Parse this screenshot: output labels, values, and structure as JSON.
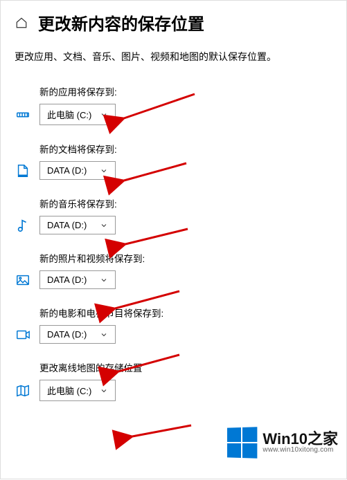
{
  "header": {
    "title": "更改新内容的保存位置"
  },
  "subtitle": "更改应用、文档、音乐、图片、视频和地图的默认保存位置。",
  "options": {
    "pc": "此电脑 (C:)",
    "data": "DATA (D:)"
  },
  "rows": [
    {
      "label": "新的应用将保存到:",
      "value": "此电脑 (C:)",
      "icon": "apps"
    },
    {
      "label": "新的文档将保存到:",
      "value": "DATA (D:)",
      "icon": "documents"
    },
    {
      "label": "新的音乐将保存到:",
      "value": "DATA (D:)",
      "icon": "music"
    },
    {
      "label": "新的照片和视频将保存到:",
      "value": "DATA (D:)",
      "icon": "photos"
    },
    {
      "label": "新的电影和电视节目将保存到:",
      "value": "DATA (D:)",
      "icon": "movies"
    },
    {
      "label": "更改离线地图的存储位置",
      "value": "此电脑 (C:)",
      "icon": "maps"
    }
  ],
  "arrow_color": "#d40000",
  "watermark": {
    "main": "Win10之家",
    "sub": "www.win10xitong.com"
  }
}
